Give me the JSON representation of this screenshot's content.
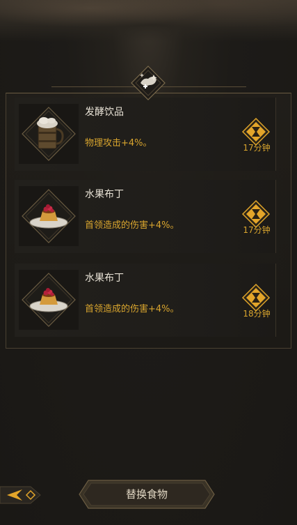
{
  "foods": [
    {
      "name": "发酵饮品",
      "effect": "物理攻击+4%。",
      "duration": "17分钟",
      "icon": "mug-icon"
    },
    {
      "name": "水果布丁",
      "effect": "首领造成的伤害+4%。",
      "duration": "17分钟",
      "icon": "pudding-icon"
    },
    {
      "name": "水果布丁",
      "effect": "首领造成的伤害+4%。",
      "duration": "18分钟",
      "icon": "pudding-icon"
    }
  ],
  "buttons": {
    "replace_label": "替换食物",
    "back_icon": "back-arrow-icon"
  },
  "colors": {
    "accent_gold": "#d9a52e",
    "text_light": "#e8e2d6",
    "background": "#1c1a17"
  }
}
